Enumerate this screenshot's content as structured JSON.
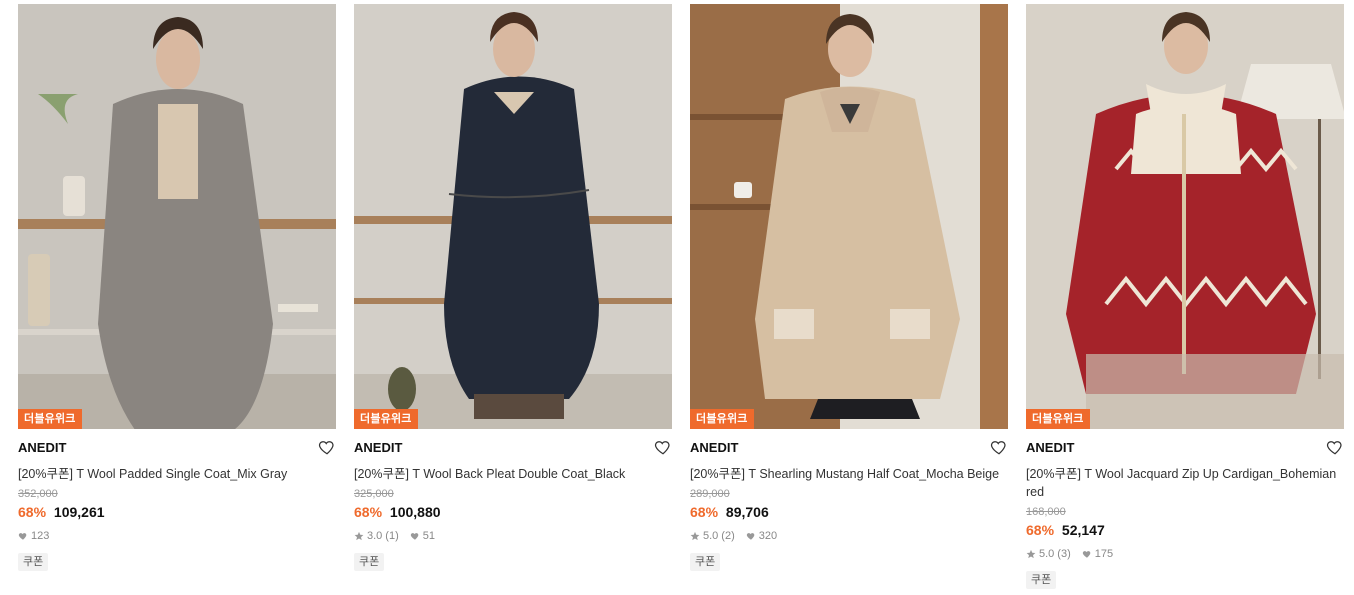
{
  "colors": {
    "accent": "#ef6a2c",
    "muted": "#999999"
  },
  "products": [
    {
      "badge": "더블유위크",
      "brand": "ANEDIT",
      "title": "[20%쿠폰] T Wool Padded Single Coat_Mix Gray",
      "original_price": "352,000",
      "discount": "68%",
      "price": "109,261",
      "rating": "",
      "reviews": "",
      "likes": "123",
      "tag": "쿠폰",
      "image_subject": "woman in gray wool single coat"
    },
    {
      "badge": "더블유위크",
      "brand": "ANEDIT",
      "title": "[20%쿠폰] T Wool Back Pleat Double Coat_Black",
      "original_price": "325,000",
      "discount": "68%",
      "price": "100,880",
      "rating": "3.0",
      "reviews": "(1)",
      "likes": "51",
      "tag": "쿠폰",
      "image_subject": "woman in navy belted double coat"
    },
    {
      "badge": "더블유위크",
      "brand": "ANEDIT",
      "title": "[20%쿠폰] T Shearling Mustang Half Coat_Mocha Beige",
      "original_price": "289,000",
      "discount": "68%",
      "price": "89,706",
      "rating": "5.0",
      "reviews": "(2)",
      "likes": "320",
      "tag": "쿠폰",
      "image_subject": "woman in beige shearling half coat"
    },
    {
      "badge": "더블유위크",
      "brand": "ANEDIT",
      "title": "[20%쿠폰] T Wool Jacquard Zip Up Cardigan_Bohemian red",
      "original_price": "168,000",
      "discount": "68%",
      "price": "52,147",
      "rating": "5.0",
      "reviews": "(3)",
      "likes": "175",
      "tag": "쿠폰",
      "image_subject": "woman in red jacquard zip cardigan"
    }
  ]
}
